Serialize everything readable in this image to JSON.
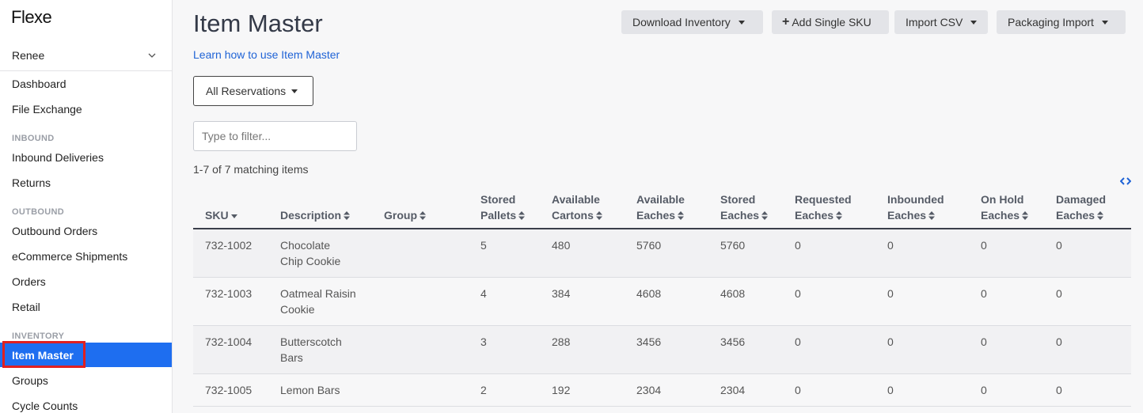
{
  "app": {
    "logo": "Flexe"
  },
  "sidebar": {
    "user": "Renee",
    "items": [
      {
        "label": "Dashboard"
      },
      {
        "label": "File Exchange"
      },
      {
        "label": "Inbound Deliveries"
      },
      {
        "label": "Returns"
      },
      {
        "label": "Outbound Orders"
      },
      {
        "label": "eCommerce Shipments"
      },
      {
        "label": "Orders"
      },
      {
        "label": "Retail"
      },
      {
        "label": "Item Master"
      },
      {
        "label": "Groups"
      },
      {
        "label": "Cycle Counts"
      }
    ],
    "sections": {
      "inbound": "INBOUND",
      "outbound": "OUTBOUND",
      "inventory": "INVENTORY"
    },
    "active_item": "Item Master"
  },
  "header": {
    "title": "Item Master",
    "learn_link": "Learn how to use Item Master",
    "buttons": {
      "download": "Download Inventory",
      "add_sku": "Add Single SKU",
      "import_csv": "Import CSV",
      "packaging": "Packaging Import"
    }
  },
  "filters": {
    "reservations": "All Reservations",
    "filter_placeholder": "Type to filter...",
    "count_text": "1-7 of 7 matching items"
  },
  "table": {
    "columns": [
      {
        "line1": "",
        "line2": "SKU"
      },
      {
        "line1": "",
        "line2": "Description"
      },
      {
        "line1": "",
        "line2": "Group"
      },
      {
        "line1": "Stored",
        "line2": "Pallets"
      },
      {
        "line1": "Available",
        "line2": "Cartons"
      },
      {
        "line1": "Available",
        "line2": "Eaches"
      },
      {
        "line1": "Stored",
        "line2": "Eaches"
      },
      {
        "line1": "Requested",
        "line2": "Eaches"
      },
      {
        "line1": "Inbounded",
        "line2": "Eaches"
      },
      {
        "line1": "On Hold",
        "line2": "Eaches"
      },
      {
        "line1": "Damaged",
        "line2": "Eaches"
      }
    ],
    "rows": [
      {
        "sku": "732-1002",
        "desc1": "Chocolate",
        "desc2": "Chip Cookie",
        "group": "",
        "stored_pallets": "5",
        "available_cartons": "480",
        "available_eaches": "5760",
        "stored_eaches": "5760",
        "requested": "0",
        "inbounded": "0",
        "on_hold": "0",
        "damaged": "0"
      },
      {
        "sku": "732-1003",
        "desc1": "Oatmeal Raisin",
        "desc2": "Cookie",
        "group": "",
        "stored_pallets": "4",
        "available_cartons": "384",
        "available_eaches": "4608",
        "stored_eaches": "4608",
        "requested": "0",
        "inbounded": "0",
        "on_hold": "0",
        "damaged": "0"
      },
      {
        "sku": "732-1004",
        "desc1": "Butterscotch",
        "desc2": "Bars",
        "group": "",
        "stored_pallets": "3",
        "available_cartons": "288",
        "available_eaches": "3456",
        "stored_eaches": "3456",
        "requested": "0",
        "inbounded": "0",
        "on_hold": "0",
        "damaged": "0"
      },
      {
        "sku": "732-1005",
        "desc1": "Lemon Bars",
        "desc2": "",
        "group": "",
        "stored_pallets": "2",
        "available_cartons": "192",
        "available_eaches": "2304",
        "stored_eaches": "2304",
        "requested": "0",
        "inbounded": "0",
        "on_hold": "0",
        "damaged": "0"
      }
    ]
  },
  "colors": {
    "accent": "#1e6ef0",
    "link": "#1f63d6",
    "highlight_outline": "#e02020"
  },
  "icons": {
    "user_toggle": "chevron-down-icon",
    "sort_desc": "sort-desc-icon",
    "sort_both": "sort-icon",
    "code_toggle": "code-icon",
    "add": "plus-icon",
    "dropdown": "caret-down-icon"
  }
}
